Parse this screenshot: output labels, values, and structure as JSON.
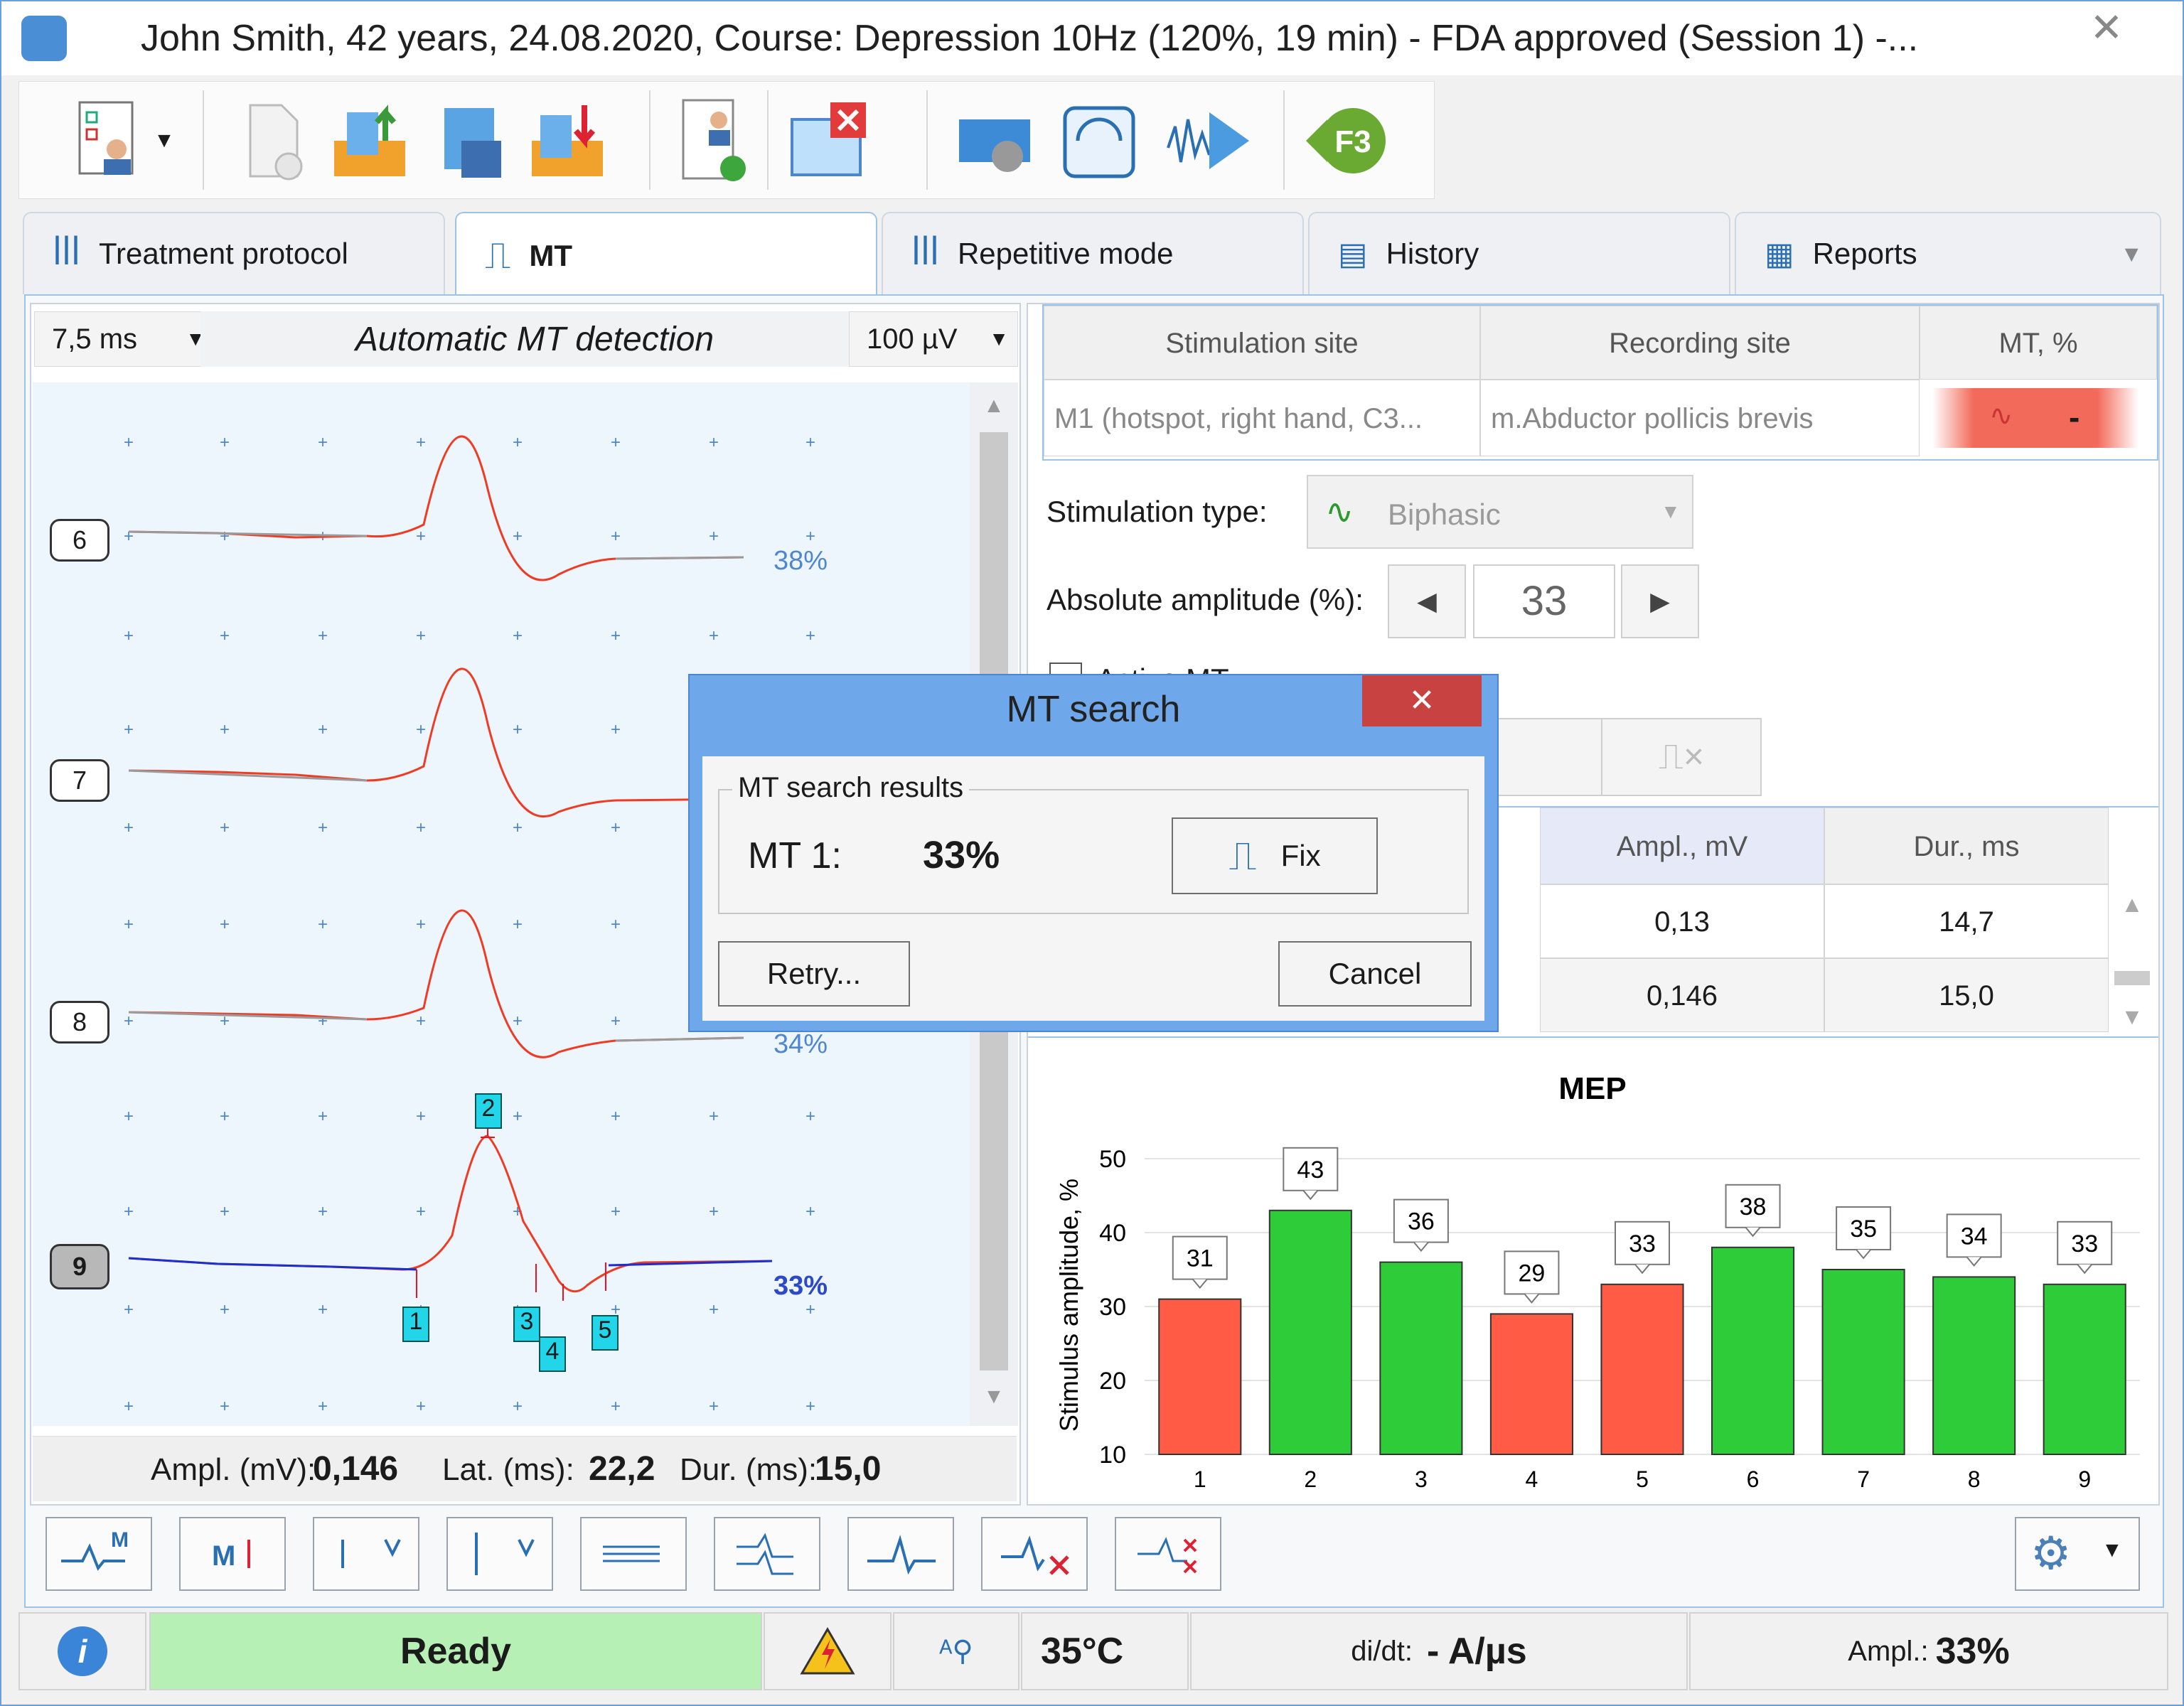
{
  "window": {
    "title": "John Smith, 42 years, 24.08.2020, Course: Depression 10Hz (120%, 19 min) - FDA approved (Session 1) -...",
    "close": "✕"
  },
  "tabs": [
    {
      "label": "Treatment protocol"
    },
    {
      "label": "MT"
    },
    {
      "label": "Repetitive mode"
    },
    {
      "label": "History"
    },
    {
      "label": "Reports"
    }
  ],
  "left": {
    "timebase": "7,5 ms",
    "mode_title": "Automatic MT detection",
    "sensitivity": "100 µV",
    "traces": [
      {
        "num": "6",
        "pct": "38%"
      },
      {
        "num": "7",
        "pct": ""
      },
      {
        "num": "8",
        "pct": "34%"
      },
      {
        "num": "9",
        "pct": "33%"
      }
    ],
    "markers": [
      "1",
      "2",
      "3",
      "4",
      "5"
    ],
    "meas": {
      "ampl_label": "Ampl. (mV):",
      "ampl": "0,146",
      "lat_label": "Lat. (ms):",
      "lat": "22,2",
      "dur_label": "Dur. (ms):",
      "dur": "15,0"
    }
  },
  "right": {
    "headers": [
      "Stimulation site",
      "Recording site",
      "MT, %"
    ],
    "site": "M1 (hotspot, right hand, C3...",
    "recording": "m.Abductor pollicis brevis",
    "mt_value": "-",
    "stim_type_label": "Stimulation type:",
    "stim_type": "Biphasic",
    "abs_amp_label": "Absolute amplitude (%):",
    "abs_amp": "33",
    "active_mt_label": "Active MT",
    "res_headers": [
      "Ampl., mV",
      "Dur., ms"
    ],
    "res_rows": [
      [
        "0,13",
        "14,7"
      ],
      [
        "0,146",
        "15,0"
      ]
    ]
  },
  "dialog": {
    "title": "MT search",
    "group": "MT search results",
    "mt_label": "MT 1:",
    "mt_value": "33%",
    "fix": "Fix",
    "retry": "Retry...",
    "cancel": "Cancel",
    "close": "✕"
  },
  "chart_data": {
    "type": "bar",
    "title": "MEP",
    "ylabel": "Stimulus amplitude, %",
    "xlabel": "",
    "categories": [
      "1",
      "2",
      "3",
      "4",
      "5",
      "6",
      "7",
      "8",
      "9"
    ],
    "values": [
      31,
      43,
      36,
      29,
      33,
      38,
      35,
      34,
      33
    ],
    "colors": [
      "#ff5b45",
      "#2ecc38",
      "#2ecc38",
      "#ff5b45",
      "#ff5b45",
      "#2ecc38",
      "#2ecc38",
      "#2ecc38",
      "#2ecc38"
    ],
    "ylim": [
      10,
      50
    ],
    "yticks": [
      "10",
      "20",
      "30",
      "40",
      "50"
    ],
    "grid": true
  },
  "status": {
    "ready": "Ready",
    "temp": "35°C",
    "didt_label": "di/dt:",
    "didt_value": "-  A/µs",
    "ampl_label": "Ampl.:",
    "ampl_value": "33%"
  }
}
